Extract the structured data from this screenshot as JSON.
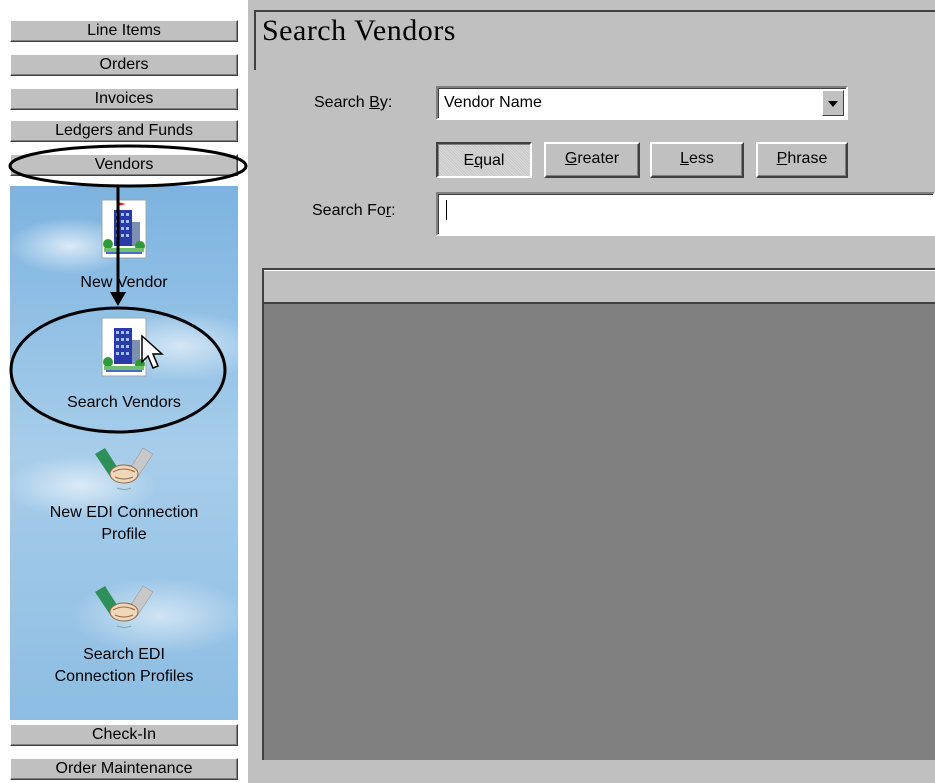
{
  "sidebar": {
    "top_items": [
      {
        "label": "Line Items"
      },
      {
        "label": "Orders"
      },
      {
        "label": "Invoices"
      },
      {
        "label": "Ledgers and Funds"
      },
      {
        "label": "Vendors"
      }
    ],
    "tasks": [
      {
        "label": "New Vendor",
        "icon": "vendor-building-icon"
      },
      {
        "label": "Search Vendors",
        "icon": "search-vendor-building-icon"
      },
      {
        "label_line1": "New EDI Connection",
        "label_line2": "Profile",
        "icon": "handshake-icon"
      },
      {
        "label_line1": "Search EDI",
        "label_line2": "Connection Profiles",
        "icon": "handshake-icon"
      }
    ],
    "bottom_items": [
      {
        "label": "Check-In"
      },
      {
        "label": "Order Maintenance"
      }
    ]
  },
  "main": {
    "title": "Search Vendors",
    "search_by": {
      "label_pre": "Search ",
      "label_key": "B",
      "label_post": "y:",
      "value": "Vendor Name"
    },
    "match_buttons": [
      {
        "pre": "E",
        "key": "q",
        "post": "ual",
        "pressed": true
      },
      {
        "pre": "",
        "key": "G",
        "post": "reater",
        "pressed": false
      },
      {
        "pre": "",
        "key": "L",
        "post": "ess",
        "pressed": false
      },
      {
        "pre": "",
        "key": "P",
        "post": "hrase",
        "pressed": false
      }
    ],
    "search_for": {
      "label_pre": "Search Fo",
      "label_key": "r",
      "label_post": ":",
      "value": ""
    }
  },
  "colors": {
    "face": "#c0c0c0",
    "results_bg": "#808080",
    "sky": "#8dbde3",
    "annotation": "#000000"
  }
}
